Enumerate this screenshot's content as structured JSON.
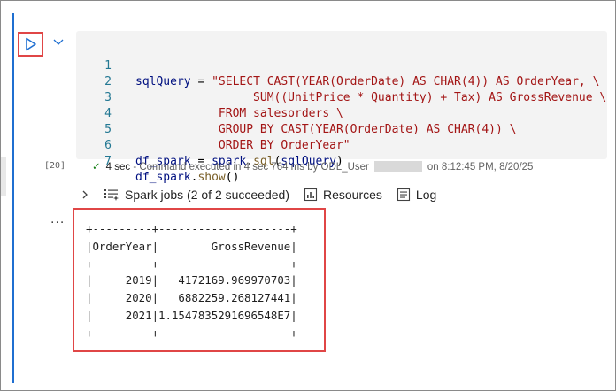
{
  "cell": {
    "execution_count": "[20]",
    "code_lines": [
      {
        "n": "1",
        "parts": [
          {
            "t": "sqlQuery",
            "c": "kw"
          },
          {
            "t": " = ",
            "c": "op"
          },
          {
            "t": "\"SELECT CAST(YEAR(OrderDate) AS CHAR(4)) AS OrderYear, \\",
            "c": "str"
          }
        ]
      },
      {
        "n": "2",
        "parts": [
          {
            "t": "                 SUM((UnitPrice * Quantity) + Tax) AS GrossRevenue \\",
            "c": "str"
          }
        ]
      },
      {
        "n": "3",
        "parts": [
          {
            "t": "            FROM salesorders \\",
            "c": "str"
          }
        ]
      },
      {
        "n": "4",
        "parts": [
          {
            "t": "            GROUP BY CAST(YEAR(OrderDate) AS CHAR(4)) \\",
            "c": "str"
          }
        ]
      },
      {
        "n": "5",
        "parts": [
          {
            "t": "            ORDER BY OrderYear\"",
            "c": "str"
          }
        ]
      },
      {
        "n": "6",
        "parts": [
          {
            "t": "df_spark",
            "c": "kw"
          },
          {
            "t": " = ",
            "c": "op"
          },
          {
            "t": "spark",
            "c": "kw"
          },
          {
            "t": ".",
            "c": "op"
          },
          {
            "t": "sql",
            "c": "fn"
          },
          {
            "t": "(",
            "c": "op"
          },
          {
            "t": "sqlQuery",
            "c": "kw"
          },
          {
            "t": ")",
            "c": "op"
          }
        ]
      },
      {
        "n": "7",
        "parts": [
          {
            "t": "df_spark",
            "c": "kw"
          },
          {
            "t": ".",
            "c": "op"
          },
          {
            "t": "show",
            "c": "fn"
          },
          {
            "t": "()",
            "c": "op"
          }
        ]
      }
    ]
  },
  "status": {
    "duration": "4 sec",
    "message": " - Command executed in 4 sec 764 ms by ODL_User",
    "timestamp": "on 8:12:45 PM, 8/20/25"
  },
  "toolbar": {
    "spark_jobs_label": "Spark jobs (2 of 2 succeeded)",
    "resources_label": "Resources",
    "log_label": "Log"
  },
  "output": {
    "lines": [
      "+---------+--------------------+",
      "|OrderYear|        GrossRevenue|",
      "+---------+--------------------+",
      "|     2019|   4172169.969970703|",
      "|     2020|   6882259.268127441|",
      "|     2021|1.1547835291696548E7|",
      "+---------+--------------------+"
    ]
  },
  "more_label": "...",
  "colors": {
    "selection_bar": "#1f6fd1",
    "highlight_border": "#e04646",
    "success": "#107c10"
  }
}
